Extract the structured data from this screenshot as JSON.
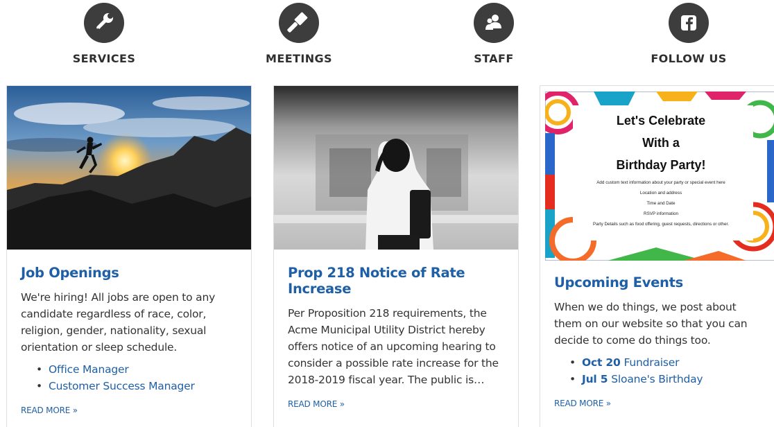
{
  "nav": {
    "items": [
      {
        "label": "SERVICES",
        "icon": "wrench-icon"
      },
      {
        "label": "MEETINGS",
        "icon": "gavel-icon"
      },
      {
        "label": "STAFF",
        "icon": "people-icon"
      },
      {
        "label": "FOLLOW US",
        "icon": "facebook-icon"
      }
    ]
  },
  "colors": {
    "accent": "#1f5fa6",
    "icon_bg": "#3d3d3d"
  },
  "cards": [
    {
      "title": "Job Openings",
      "text": "We're hiring! All jobs are open to any candidate regardless of race, color, religion, gender, nationality, sexual orientation or sleep schedule.",
      "links": [
        "Office Manager",
        "Customer Success Manager"
      ],
      "read_more": "READ MORE »"
    },
    {
      "title": "Prop 218 Notice of Rate Increase",
      "text": "Per Proposition 218 requirements, the Acme Municipal Utility District hereby offers notice of an upcoming hearing to consider a possible rate increase for the 2018-2019 fiscal year. The public is…",
      "read_more": "READ MORE »"
    },
    {
      "title": "Upcoming Events",
      "text": "When we do things, we post about them on our website so that you can decide to come do things too.",
      "events": [
        {
          "date": "Oct 20",
          "name": "Fundraiser"
        },
        {
          "date": "Jul 5",
          "name": "Sloane's Birthday"
        }
      ],
      "read_more": "READ MORE »",
      "flyer": {
        "line1": "Let's Celebrate",
        "line2": "With a",
        "line3": "Birthday Party!",
        "small1": "Add custom text information about your party or special event here",
        "small2": "Location and address",
        "small3": "Time and Date",
        "small4": "RSVP information",
        "small5": "Party Details such as food offering, guest requests, directions or other."
      }
    }
  ]
}
